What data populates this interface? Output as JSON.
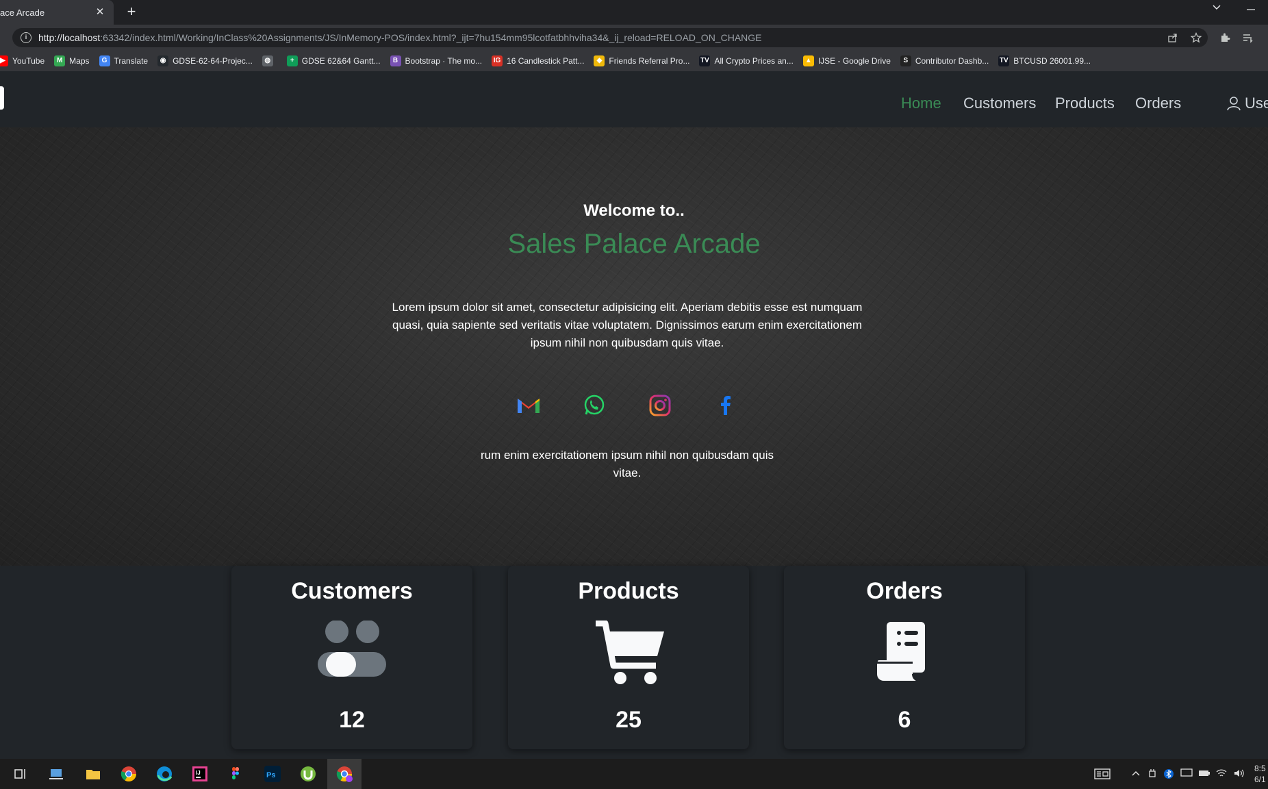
{
  "browser": {
    "tab_title": "ace Arcade",
    "close_glyph": "✕",
    "newtab_glyph": "+",
    "url_host": "http://localhost",
    "url_rest": ":63342/index.html/Working/InClass%20Assignments/JS/InMemory-POS/index.html?_ijt=7hu154mm95lcotfatbhhviha34&_ij_reload=RELOAD_ON_CHANGE",
    "bookmarks": [
      {
        "label": "YouTube",
        "color": "#ff0000",
        "glyph": "▶"
      },
      {
        "label": "Maps",
        "color": "#34a853",
        "glyph": "M"
      },
      {
        "label": "Translate",
        "color": "#4285f4",
        "glyph": "G"
      },
      {
        "label": "GDSE-62-64-Projec...",
        "color": "#24292e",
        "glyph": "◉"
      },
      {
        "label": "",
        "color": "#5f6368",
        "glyph": "◍"
      },
      {
        "label": "GDSE 62&64 Gantt...",
        "color": "#0f9d58",
        "glyph": "+"
      },
      {
        "label": "Bootstrap · The mo...",
        "color": "#7952b3",
        "glyph": "B"
      },
      {
        "label": "16 Candlestick Patt...",
        "color": "#d93025",
        "glyph": "IG"
      },
      {
        "label": "Friends Referral Pro...",
        "color": "#f0b90b",
        "glyph": "◆"
      },
      {
        "label": "All Crypto Prices an...",
        "color": "#131722",
        "glyph": "TV"
      },
      {
        "label": "IJSE - Google Drive",
        "color": "#fbbc04",
        "glyph": "▲"
      },
      {
        "label": "Contributor Dashb...",
        "color": "#222222",
        "glyph": "S"
      },
      {
        "label": "BTCUSD 26001.99...",
        "color": "#131722",
        "glyph": "TV"
      }
    ]
  },
  "nav": {
    "links": [
      "Home",
      "Customers",
      "Products",
      "Orders"
    ],
    "user_label": "Use"
  },
  "hero": {
    "welcome": "Welcome to..",
    "title": "Sales Palace Arcade",
    "text": "Lorem ipsum dolor sit amet, consectetur adipisicing elit. Aperiam debitis esse est numquam quasi, quia sapiente sed veritatis vitae voluptatem. Dignissimos earum enim exercitationem ipsum nihil non quibusdam quis vitae.",
    "text2": "rum enim exercitationem ipsum nihil non quibusdam quis vitae.",
    "accent": "#3a8b55"
  },
  "cards": [
    {
      "title": "Customers",
      "count": "12",
      "icon": "users-toggle-icon"
    },
    {
      "title": "Products",
      "count": "25",
      "icon": "cart-icon"
    },
    {
      "title": "Orders",
      "count": "6",
      "icon": "receipt-icon"
    }
  ],
  "taskbar": {
    "clock_time": "8:5",
    "clock_date": "6/1"
  }
}
